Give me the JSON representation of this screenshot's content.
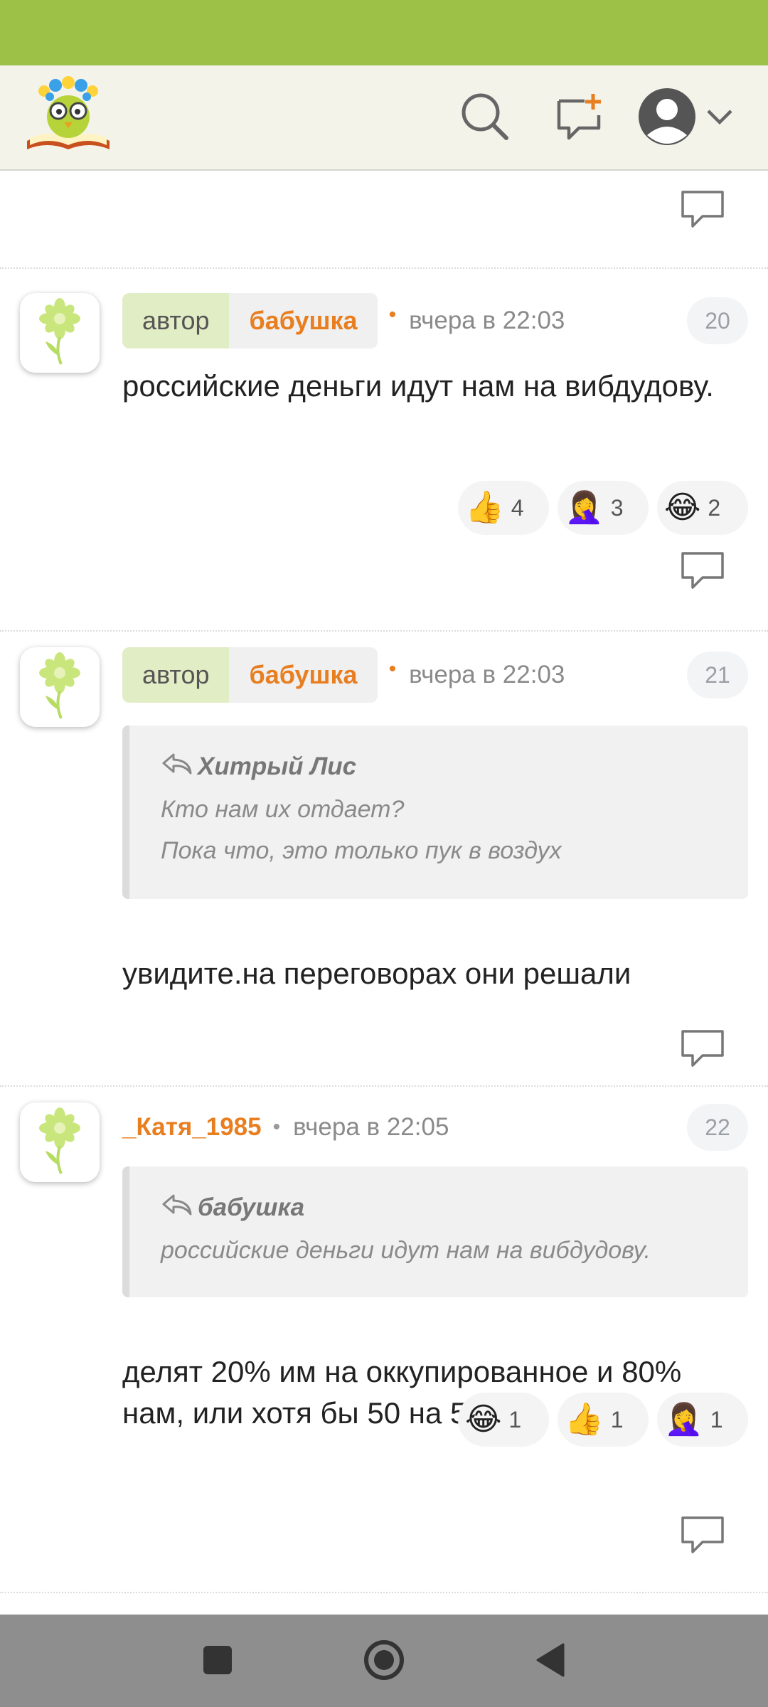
{
  "header": {
    "logo": "owl-book-logo",
    "search_icon": "search-icon",
    "compose_icon": "new-message-icon",
    "profile_icon": "profile-icon"
  },
  "posts": [
    {
      "author_label": "автор",
      "author": "бабушка",
      "time": "вчера в 22:03",
      "number": "20",
      "text": "российские деньги идут нам на вибдудову.",
      "reactions": [
        {
          "emoji": "👍",
          "count": "4"
        },
        {
          "emoji": "🤦‍♀️",
          "count": "3"
        },
        {
          "emoji": "😂",
          "count": "2"
        }
      ]
    },
    {
      "author_label": "автор",
      "author": "бабушка",
      "time": "вчера в 22:03",
      "number": "21",
      "quote": {
        "author": "Хитрый Лис",
        "lines": [
          "Кто нам их отдает?",
          "Пока что, это только пук в воздух"
        ]
      },
      "text": "увидите.на переговорах они решали"
    },
    {
      "author": "_Катя_1985",
      "time": "вчера в 22:05",
      "number": "22",
      "quote": {
        "author": "бабушка",
        "lines": [
          "российские деньги идут нам на вибдудову."
        ]
      },
      "text": "делят 20% им на оккупированное и 80% нам, или хотя бы 50 на 50",
      "reactions": [
        {
          "emoji": "😂",
          "count": "1"
        },
        {
          "emoji": "👍",
          "count": "1"
        },
        {
          "emoji": "🤦‍♀️",
          "count": "1"
        }
      ]
    }
  ],
  "colors": {
    "accent": "#9dc146",
    "author_name": "#e87e1f",
    "header_bg": "#f3f3ea"
  }
}
